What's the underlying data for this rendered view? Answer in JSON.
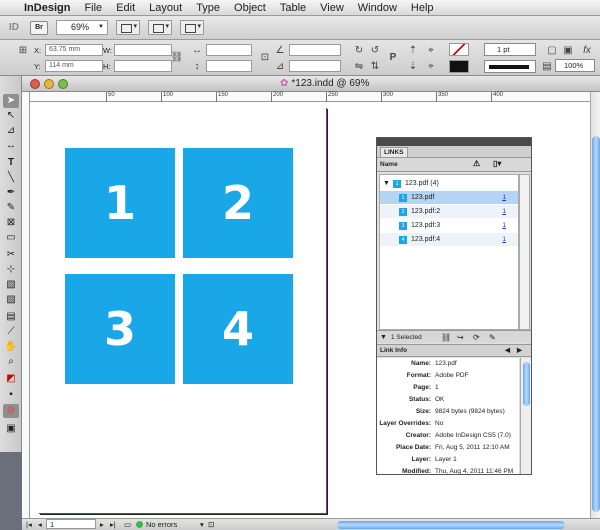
{
  "menubar": {
    "apple": "",
    "app": "InDesign",
    "items": [
      "File",
      "Edit",
      "Layout",
      "Type",
      "Object",
      "Table",
      "View",
      "Window",
      "Help"
    ]
  },
  "appbar": {
    "logo": "ID",
    "bridge": "Br",
    "zoom": "69%"
  },
  "control": {
    "x_label": "X:",
    "x_value": "63.75 mm",
    "y_label": "Y:",
    "y_value": "114 mm",
    "w_label": "W:",
    "h_label": "H:",
    "stroke_weight": "1 pt",
    "opacity": "100%"
  },
  "document": {
    "title": "*123.indd @ 69%",
    "ruler_marks": [
      "50",
      "100",
      "150",
      "200",
      "250",
      "300",
      "350",
      "400"
    ],
    "tiles": [
      "1",
      "2",
      "3",
      "4"
    ]
  },
  "status": {
    "page": "1",
    "errors": "No errors"
  },
  "links_panel": {
    "tab": "LINKS",
    "column_name": "Name",
    "group": {
      "name": "123.pdf (4)",
      "badge": "1"
    },
    "items": [
      {
        "badge": "1",
        "name": "123.pdf",
        "page": "1"
      },
      {
        "badge": "2",
        "name": "123.pdf:2",
        "page": "1"
      },
      {
        "badge": "3",
        "name": "123.pdf:3",
        "page": "1"
      },
      {
        "badge": "4",
        "name": "123.pdf:4",
        "page": "1"
      }
    ],
    "selected": "1 Selected",
    "info_title": "Link Info",
    "info": [
      {
        "k": "Name:",
        "v": "123.pdf"
      },
      {
        "k": "Format:",
        "v": "Adobe PDF"
      },
      {
        "k": "Page:",
        "v": "1"
      },
      {
        "k": "Status:",
        "v": "OK"
      },
      {
        "k": "Size:",
        "v": "9824 bytes (9824 bytes)"
      },
      {
        "k": "Layer Overrides:",
        "v": "No"
      },
      {
        "k": "Creator:",
        "v": "Adobe InDesign CS5 (7.0)"
      },
      {
        "k": "Place Date:",
        "v": "Fri, Aug 5, 2011 12:10 AM"
      },
      {
        "k": "Layer:",
        "v": "Layer 1"
      },
      {
        "k": "Modified:",
        "v": "Thu, Aug 4, 2011 11:46 PM"
      }
    ]
  },
  "colors": {
    "tile": "#1aa7e8",
    "selection": "#b5d3f3",
    "scroll_thumb": "#6aa8e8"
  }
}
